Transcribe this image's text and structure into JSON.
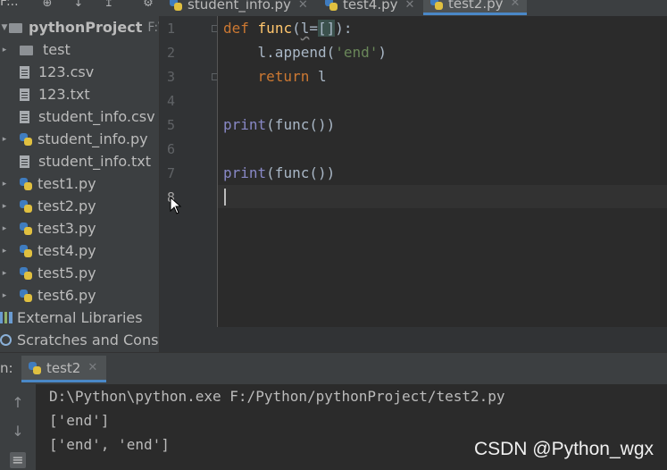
{
  "toolbar": {
    "cut_label": "F:..",
    "icons": [
      "settings-icon",
      "locate-icon",
      "collapse-icon",
      "expand-icon"
    ]
  },
  "editor_tabs": [
    {
      "label": "student_info.py",
      "active": false
    },
    {
      "label": "test4.py",
      "active": false
    },
    {
      "label": "test2.py",
      "active": true
    }
  ],
  "project": {
    "root_name": "pythonProject",
    "root_path": "F:\\Py",
    "items": [
      {
        "label": "test",
        "type": "folder",
        "expandable": true
      },
      {
        "label": "123.csv",
        "type": "file",
        "expandable": false
      },
      {
        "label": "123.txt",
        "type": "file",
        "expandable": false
      },
      {
        "label": "student_info.csv",
        "type": "file",
        "expandable": false
      },
      {
        "label": "student_info.py",
        "type": "python",
        "expandable": true
      },
      {
        "label": "student_info.txt",
        "type": "file",
        "expandable": false
      },
      {
        "label": "test1.py",
        "type": "python",
        "expandable": true
      },
      {
        "label": "test2.py",
        "type": "python",
        "expandable": true
      },
      {
        "label": "test3.py",
        "type": "python",
        "expandable": true
      },
      {
        "label": "test4.py",
        "type": "python",
        "expandable": true
      },
      {
        "label": "test5.py",
        "type": "python",
        "expandable": true
      },
      {
        "label": "test6.py",
        "type": "python",
        "expandable": true
      }
    ],
    "external_libraries": "External Libraries",
    "scratches": "Scratches and Conso"
  },
  "editor": {
    "line_numbers": [
      "1",
      "2",
      "3",
      "4",
      "5",
      "6",
      "7",
      "8"
    ],
    "code": {
      "line1": {
        "kw": "def",
        "fn": "func",
        "open": "(",
        "param": "l",
        "eq": "=",
        "default": "[]",
        "close": "):"
      },
      "line2": {
        "obj": "l",
        "call": ".append(",
        "str": "'end'",
        "close": ")"
      },
      "line3": {
        "kw": "return",
        "rest": " l"
      },
      "line5": {
        "bi": "print",
        "rest": "(func())"
      },
      "line7": {
        "bi": "print",
        "rest": "(func())"
      }
    },
    "current_line": "8"
  },
  "run": {
    "panel_prefix": "n:",
    "tab_label": "test2",
    "console": [
      "D:\\Python\\python.exe F:/Python/pythonProject/test2.py",
      "['end']",
      "['end', 'end']"
    ]
  },
  "watermark": "CSDN @Python_wgx"
}
